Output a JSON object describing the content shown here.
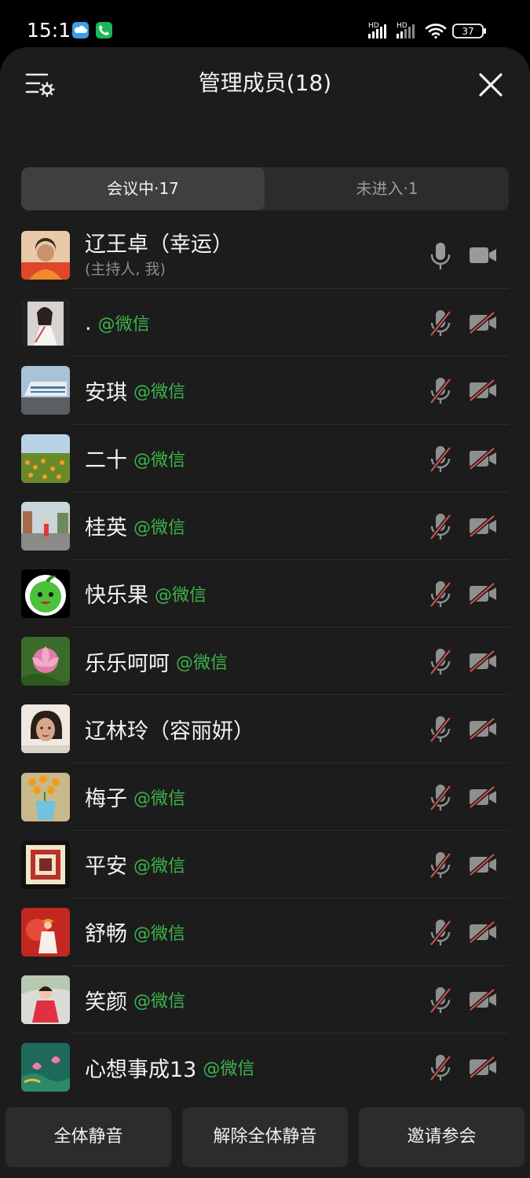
{
  "status": {
    "time": "15:11",
    "signal1": "HD",
    "signal2": "HD",
    "battery": "37"
  },
  "header": {
    "title": "管理成员(18)",
    "settings_icon": "list-settings-icon",
    "close_icon": "close-icon"
  },
  "tabs": [
    {
      "label": "会议中·17",
      "active": true
    },
    {
      "label": "未进入·1",
      "active": false
    }
  ],
  "host": {
    "name": "辽王卓（幸运）",
    "role": "(主持人, 我)",
    "mic": "on",
    "camera": "on"
  },
  "members": [
    {
      "name": ".",
      "tag": "@微信",
      "mic": "muted",
      "camera": "off"
    },
    {
      "name": "安琪",
      "tag": "@微信",
      "mic": "muted",
      "camera": "off"
    },
    {
      "name": "二十",
      "tag": "@微信",
      "mic": "muted",
      "camera": "off"
    },
    {
      "name": "桂英",
      "tag": "@微信",
      "mic": "muted",
      "camera": "off"
    },
    {
      "name": "快乐果",
      "tag": "@微信",
      "mic": "muted",
      "camera": "off"
    },
    {
      "name": "乐乐呵呵",
      "tag": "@微信",
      "mic": "muted",
      "camera": "off"
    },
    {
      "name": "辽林玲（容丽妍）",
      "tag": "",
      "mic": "muted",
      "camera": "off"
    },
    {
      "name": "梅子",
      "tag": "@微信",
      "mic": "muted",
      "camera": "off"
    },
    {
      "name": "平安",
      "tag": "@微信",
      "mic": "muted",
      "camera": "off"
    },
    {
      "name": "舒畅",
      "tag": "@微信",
      "mic": "muted",
      "camera": "off"
    },
    {
      "name": "笑颜",
      "tag": "@微信",
      "mic": "muted",
      "camera": "off"
    },
    {
      "name": "心想事成13",
      "tag": "@微信",
      "mic": "muted",
      "camera": "off"
    }
  ],
  "footer": {
    "mute_all": "全体静音",
    "unmute_all": "解除全体静音",
    "invite": "邀请参会"
  },
  "colors": {
    "accent_green": "#3cb44b",
    "muted_red": "#d9534f",
    "background": "#1c1c1c"
  }
}
